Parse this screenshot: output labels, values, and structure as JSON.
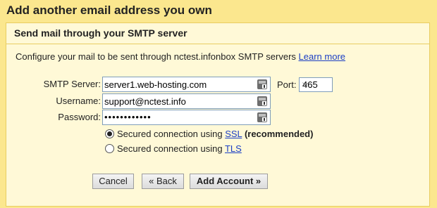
{
  "dialog": {
    "title": "Add another email address you own",
    "subheading": "Send mail through your SMTP server",
    "description": "Configure your mail to be sent through nctest.infonbox SMTP servers",
    "learn_more": "Learn more"
  },
  "form": {
    "smtp_label": "SMTP Server:",
    "smtp_value": "server1.web-hosting.com",
    "port_label": "Port:",
    "port_value": "465",
    "username_label": "Username:",
    "username_value": "support@nctest.info",
    "password_label": "Password:",
    "password_mask": "••••••••••••",
    "ssl_prefix": "Secured connection using ",
    "ssl_link": "SSL",
    "ssl_suffix": "(recommended)",
    "tls_prefix": "Secured connection using ",
    "tls_link": "TLS",
    "selected_security": "SSL"
  },
  "buttons": {
    "cancel": "Cancel",
    "back": "« Back",
    "add_account": "Add Account »"
  },
  "icons": {
    "field_icon": "password-manager-key-icon",
    "port_dropdown": "chevron-down-icon",
    "radio_selected": "radio-checked-icon",
    "radio_unselected": "radio-unchecked-icon"
  }
}
